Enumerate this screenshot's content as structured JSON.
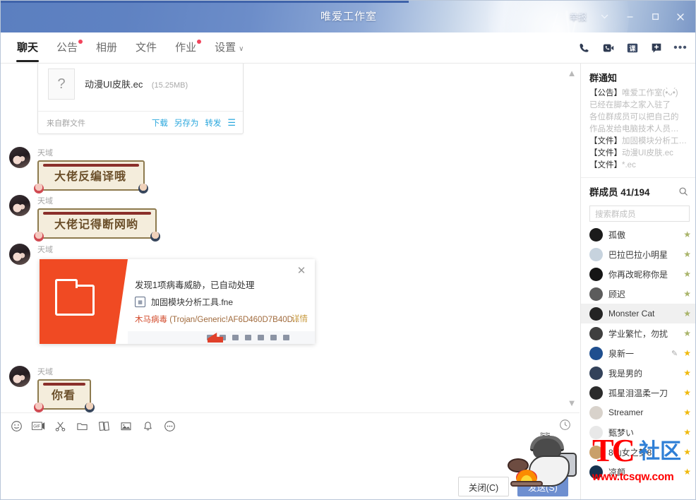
{
  "titlebar": {
    "title": "唯爱工作室",
    "report_label": "举报",
    "chevron_icon": "chevron-down-icon",
    "minimize_label": "—",
    "maximize_label": "☐",
    "close_label": "✕"
  },
  "nav": {
    "tabs": [
      {
        "label": "聊天",
        "active": true,
        "dot": false
      },
      {
        "label": "公告",
        "active": false,
        "dot": true
      },
      {
        "label": "相册",
        "active": false,
        "dot": false
      },
      {
        "label": "文件",
        "active": false,
        "dot": false
      },
      {
        "label": "作业",
        "active": false,
        "dot": true
      },
      {
        "label": "设置",
        "active": false,
        "dot": false,
        "chevron": "∨"
      }
    ],
    "tools": [
      {
        "name": "phone-call-icon"
      },
      {
        "name": "video-call-icon"
      },
      {
        "name": "class-icon",
        "label": "课"
      },
      {
        "name": "add-chat-icon"
      },
      {
        "name": "more-options-icon",
        "label": "•••"
      }
    ]
  },
  "chat": {
    "scroll_up_icon": "chevron-up-icon",
    "scroll_down_icon": "chevron-down-icon",
    "file_card": {
      "icon": "unknown-file-icon",
      "icon_glyph": "?",
      "name": "动漫UI皮肤.ec",
      "size": "(15.25MB)",
      "source": "来自群文件",
      "actions": [
        "下载",
        "另存为",
        "转发"
      ],
      "menu_icon": "hamburger-icon"
    },
    "messages": [
      {
        "sender": "天域",
        "text": "大佬反编译哦"
      },
      {
        "sender": "天域",
        "text": "大佬记得断网哟"
      },
      {
        "sender": "天域",
        "text": ""
      },
      {
        "sender": "天域",
        "text": "你看"
      }
    ]
  },
  "toast": {
    "title": "发现1项病毒威胁，已自动处理",
    "file_icon": "exe-file-icon",
    "file_name": "加固模块分析工具.fne",
    "virus_label": "木马病毒",
    "virus_signature": "(Trojan/Generic!AF6D460D7B40D...",
    "detail_link": "详情",
    "close_icon": "close-icon",
    "folder_icon": "folder-icon"
  },
  "input": {
    "toolbar": [
      {
        "name": "emoji-icon"
      },
      {
        "name": "gif-icon",
        "label": "GIF"
      },
      {
        "name": "screenshot-scissors-icon"
      },
      {
        "name": "folder-icon"
      },
      {
        "name": "code-snippet-icon"
      },
      {
        "name": "image-icon"
      },
      {
        "name": "bell-shake-icon"
      },
      {
        "name": "more-icon"
      }
    ],
    "history_icon": "chat-history-clock-icon",
    "editor_value": "",
    "editor_placeholder": "",
    "close_button": "关闭(C)",
    "send_button": "发送(S)"
  },
  "right_panel": {
    "notice": {
      "heading": "群通知",
      "lines": [
        {
          "tag": "【公告】",
          "text": "唯爱工作室(•̀ᴗ•́)",
          "blur": true
        },
        {
          "tag": "",
          "text": "已经在脚本之家入驻了",
          "blur": true
        },
        {
          "tag": "",
          "text": "各位群成员可以把自己的",
          "blur": true
        },
        {
          "tag": "",
          "text": "作品发给电脑技术人员…",
          "blur": true
        },
        {
          "tag": "【文件】",
          "text": "加固模块分析工…",
          "blur": true
        },
        {
          "tag": "【文件】",
          "text": "动漫UI皮肤.ec",
          "blur": true
        },
        {
          "tag": "【文件】",
          "text": "*.ec",
          "blur": true
        }
      ]
    },
    "members": {
      "heading": "群成员 41/194",
      "search_icon": "search-icon",
      "search_placeholder": "搜索群成员",
      "list": [
        {
          "name": "孤傲",
          "avatar": "#1b1b1b",
          "star": "grey",
          "hovered": false,
          "pencil": false
        },
        {
          "name": "巴拉巴拉小明星",
          "avatar": "#c7d3de",
          "star": "grey",
          "hovered": false,
          "pencil": false
        },
        {
          "name": "你再改昵称你是",
          "avatar": "#151515",
          "star": "grey",
          "hovered": false,
          "pencil": false
        },
        {
          "name": "顾迟",
          "avatar": "#5c5c5c",
          "star": "grey",
          "hovered": false,
          "pencil": false
        },
        {
          "name": "Monster Cat",
          "avatar": "#232323",
          "star": "grey",
          "hovered": true,
          "pencil": false
        },
        {
          "name": "学业繁忙，勿扰",
          "avatar": "#3f3f3f",
          "star": "grey",
          "hovered": false,
          "pencil": false
        },
        {
          "name": "泉新一",
          "avatar": "#1f4f8f",
          "star": "gold",
          "hovered": false,
          "pencil": true
        },
        {
          "name": "我是男的",
          "avatar": "#33425a",
          "star": "gold",
          "hovered": false,
          "pencil": false
        },
        {
          "name": "孤星泪温柔一刀",
          "avatar": "#2b2b2b",
          "star": "gold",
          "hovered": false,
          "pencil": false
        },
        {
          "name": "Streamer",
          "avatar": "#d8d2cb",
          "star": "gold",
          "hovered": false,
          "pencil": false
        },
        {
          "name": "甄梦い",
          "avatar": "#e8e8e8",
          "star": "gold",
          "hovered": false,
          "pencil": false
        },
        {
          "name": "8仙女之梦8",
          "avatar": "#c9a06a",
          "star": "gold",
          "hovered": false,
          "pencil": false
        },
        {
          "name": "凉颜",
          "avatar": "#16324f",
          "star": "gold",
          "hovered": false,
          "pencil": false
        }
      ]
    }
  },
  "watermark": {
    "tc": "TC",
    "sq": "社区",
    "url": "www.tcsqw.com",
    "tc_color": "#ff0000",
    "sq_color": "#2f7fd6"
  }
}
